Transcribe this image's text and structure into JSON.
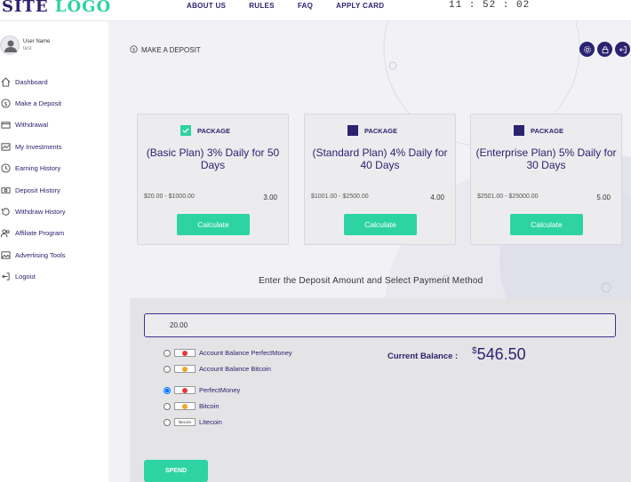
{
  "header": {
    "logo_site": "SITE",
    "logo_word": "LOGO",
    "nav": [
      "ABOUT US",
      "RULES",
      "FAQ",
      "APPLY CARD"
    ],
    "clock": "11 : 52 : 02"
  },
  "user": {
    "label": "User Name",
    "login": "test"
  },
  "sidebar": {
    "items": [
      {
        "label": "Dashboard",
        "icon": "home-icon"
      },
      {
        "label": "Make a Deposit",
        "icon": "dollar-circle-icon"
      },
      {
        "label": "Withdrawal",
        "icon": "wallet-icon"
      },
      {
        "label": "My Investments",
        "icon": "chart-icon"
      },
      {
        "label": "Earning History",
        "icon": "clock-icon"
      },
      {
        "label": "Deposit History",
        "icon": "money-icon"
      },
      {
        "label": "Withdraw History",
        "icon": "history-icon"
      },
      {
        "label": "Affiliate Program",
        "icon": "users-icon"
      },
      {
        "label": "Advertising Tools",
        "icon": "image-icon"
      },
      {
        "label": "Logout",
        "icon": "logout-icon"
      }
    ]
  },
  "page": {
    "title": "MAKE A DEPOSIT"
  },
  "plans": [
    {
      "package_label": "PACKAGE",
      "name": "(Basic Plan) 3% Daily for 50 Days",
      "range": "$20.00 - $1000.00",
      "percent": "3.00",
      "button": "Calculate",
      "selected": true
    },
    {
      "package_label": "PACKAGE",
      "name": "(Standard Plan) 4% Daily for 40 Days",
      "range": "$1001.00 - $2500.00",
      "percent": "4.00",
      "button": "Calculate",
      "selected": false
    },
    {
      "package_label": "PACKAGE",
      "name": "(Enterprise Plan) 5% Daily for 30 Days",
      "range": "$2501.00 - $25000.00",
      "percent": "5.00",
      "button": "Calculate",
      "selected": false
    }
  ],
  "form": {
    "headline": "Enter the Deposit Amount and Select Payment Method",
    "amount": "20.00",
    "methods": [
      {
        "label": "Account Balance PerfectMoney",
        "chip": "PM",
        "selected": false
      },
      {
        "label": "Account Balance Bitcoin",
        "chip": "BTC",
        "selected": false
      },
      {
        "label": "PerfectMoney",
        "chip": "PM",
        "selected": true
      },
      {
        "label": "Bitcoin",
        "chip": "BTC",
        "selected": false
      },
      {
        "label": "Litecoin",
        "chip": "litecoin",
        "selected": false
      }
    ],
    "balance_label": "Current Balance :",
    "balance_currency": "$",
    "balance_value": "546.50",
    "submit": "SPEND"
  },
  "colors": {
    "primary": "#2b2270",
    "accent": "#2ed3a3",
    "pm": "#e23b3b",
    "btc": "#f3a32a"
  }
}
